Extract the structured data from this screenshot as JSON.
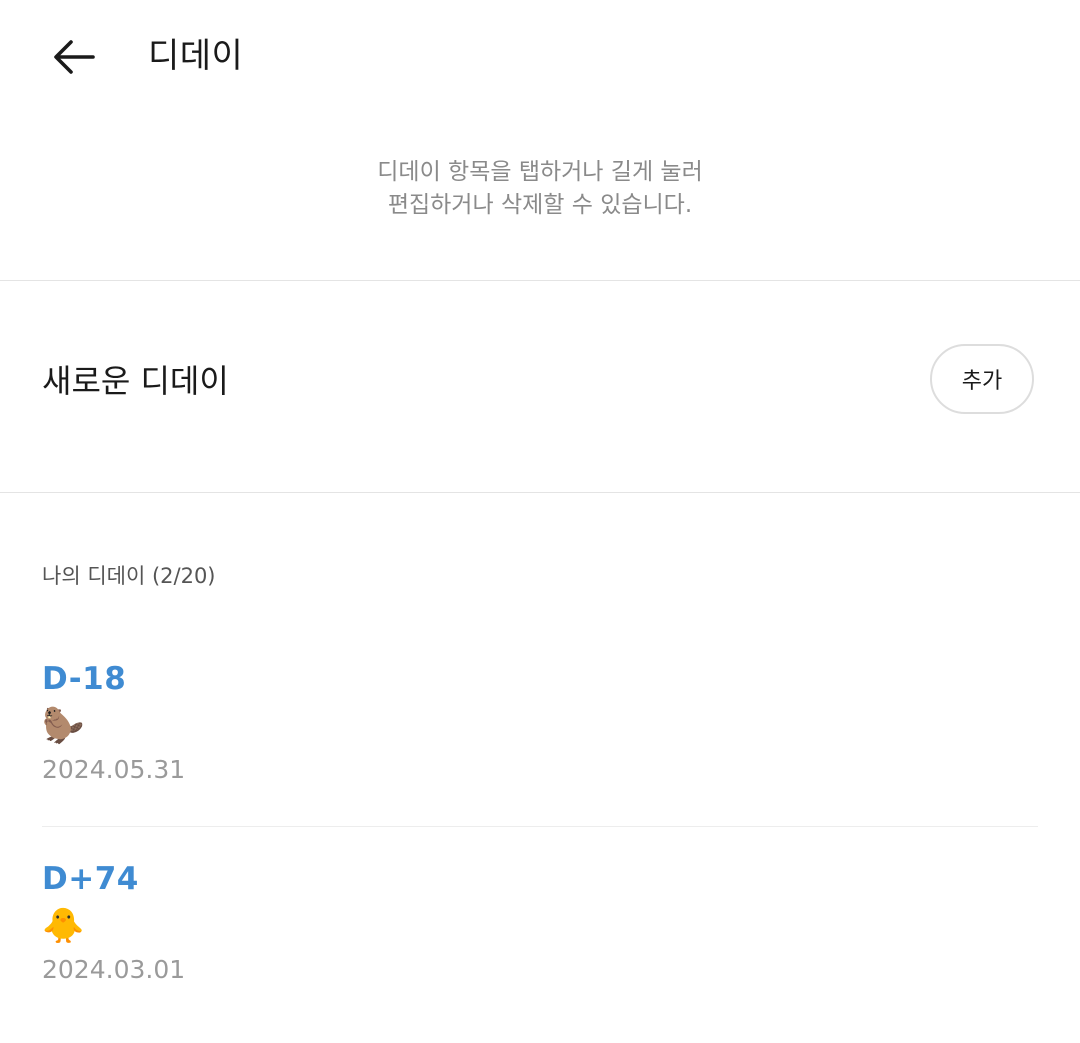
{
  "header": {
    "back_icon": "arrow-left-icon",
    "title": "디데이"
  },
  "hint": {
    "line1": "디데이 항목을 탭하거나 길게 눌러",
    "line2": "편집하거나 삭제할 수 있습니다."
  },
  "new_dday": {
    "label": "새로운 디데이",
    "add_label": "추가"
  },
  "my_ddays": {
    "section_label": "나의 디데이 (2/20)",
    "accent_color": "#3f8bd2",
    "items": [
      {
        "count": "D-18",
        "emoji": "🦫",
        "date": "2024.05.31"
      },
      {
        "count": "D+74",
        "emoji": "🐥",
        "date": "2024.03.01"
      }
    ]
  }
}
